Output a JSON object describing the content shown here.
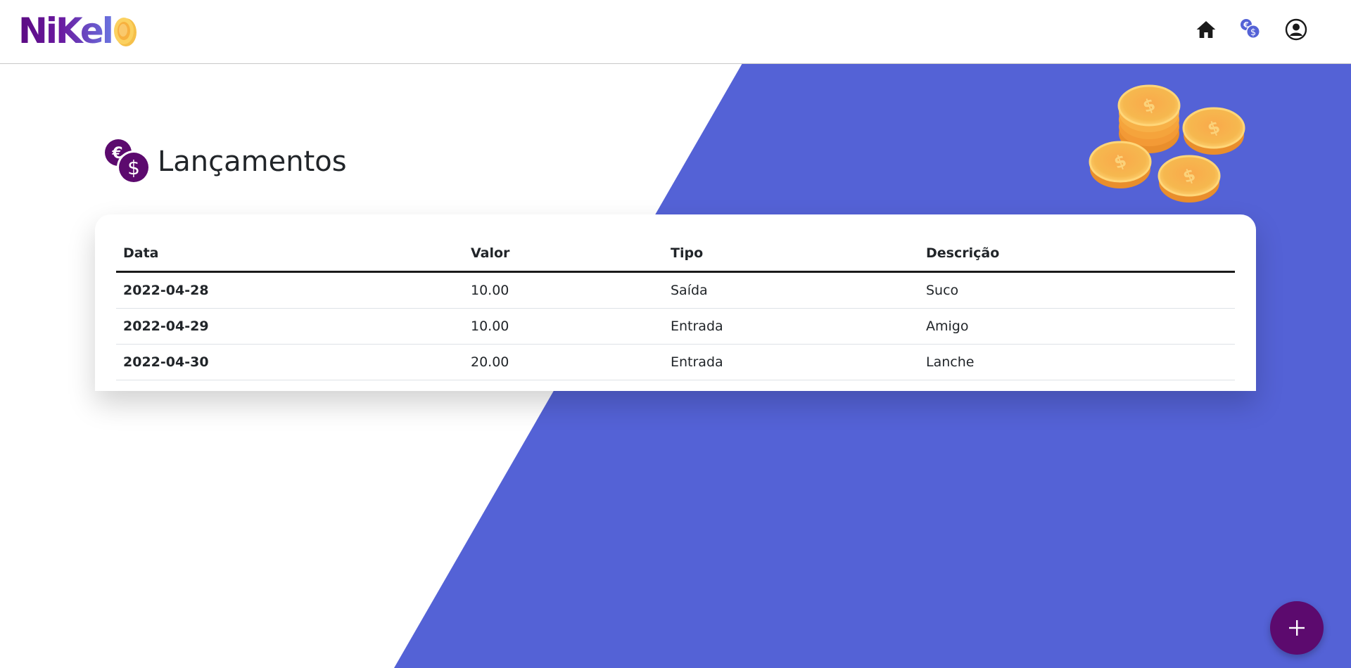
{
  "brand": {
    "name": "NiKel",
    "accent_color": "#5c0a6e",
    "secondary_color": "#5462d6"
  },
  "nav": {
    "icons": [
      "home-icon",
      "currency-icon",
      "user-circle-icon"
    ]
  },
  "header": {
    "title": "Lançamentos",
    "icon": "euro-dollar-coins-icon"
  },
  "table": {
    "columns": [
      "Data",
      "Valor",
      "Tipo",
      "Descrição"
    ],
    "rows": [
      {
        "data": "2022-04-28",
        "valor": "10.00",
        "tipo": "Saída",
        "descricao": "Suco"
      },
      {
        "data": "2022-04-29",
        "valor": "10.00",
        "tipo": "Entrada",
        "descricao": "Amigo"
      },
      {
        "data": "2022-04-30",
        "valor": "20.00",
        "tipo": "Entrada",
        "descricao": "Lanche"
      }
    ]
  },
  "fab": {
    "icon": "plus-icon",
    "color": "#5c0a6e"
  }
}
